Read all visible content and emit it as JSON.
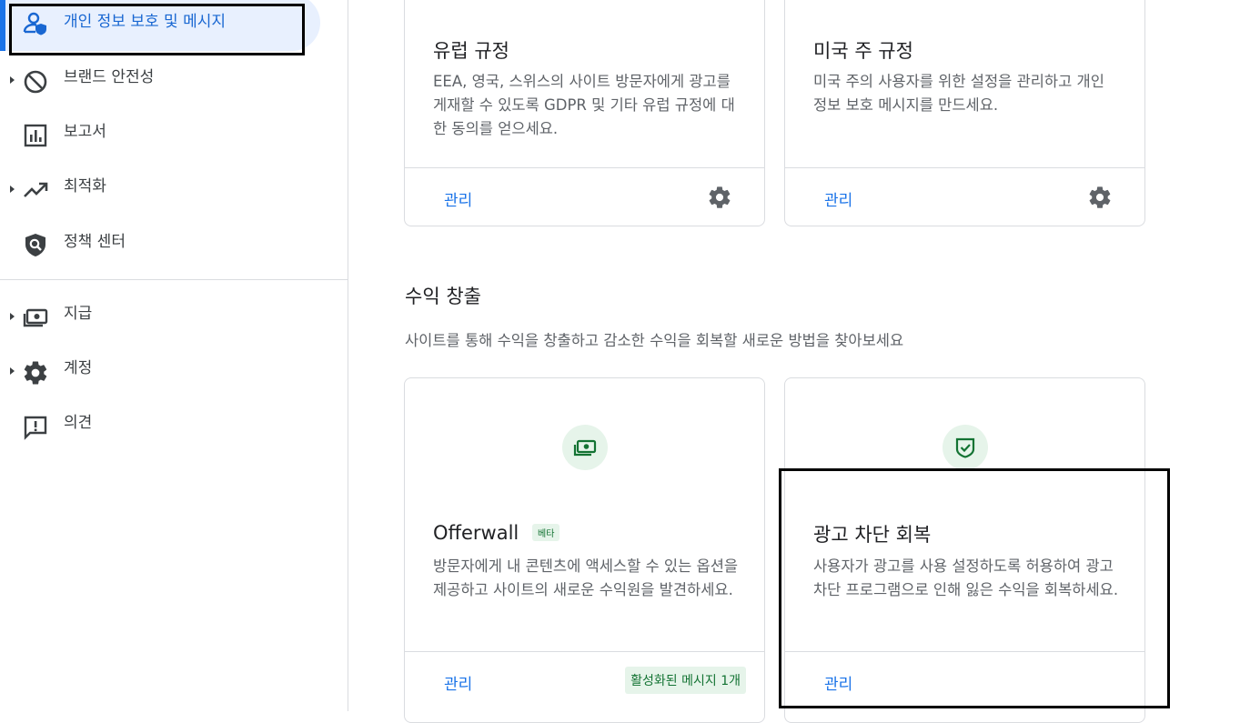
{
  "sidebar": {
    "items": [
      {
        "label": "개인 정보 보호 및 메시지",
        "icon": "privacy-messaging-icon"
      },
      {
        "label": "브랜드 안전성",
        "icon": "block-icon"
      },
      {
        "label": "보고서",
        "icon": "report-chart-icon"
      },
      {
        "label": "최적화",
        "icon": "trending-up-icon"
      },
      {
        "label": "정책 센터",
        "icon": "policy-shield-icon"
      },
      {
        "label": "지급",
        "icon": "payments-icon"
      },
      {
        "label": "계정",
        "icon": "gear-icon"
      },
      {
        "label": "의견",
        "icon": "feedback-icon"
      }
    ]
  },
  "cards": {
    "eu": {
      "title": "유럽 규정",
      "desc": "EEA, 영국, 스위스의 사이트 방문자에게 광고를 게재할 수 있도록 GDPR 및 기타 유럽 규정에 대한 동의를 얻으세요.",
      "manage": "관리"
    },
    "us": {
      "title": "미국 주 규정",
      "desc": "미국 주의 사용자를 위한 설정을 관리하고 개인 정보 보호 메시지를 만드세요.",
      "manage": "관리"
    },
    "offerwall": {
      "title": "Offerwall",
      "badge": "베타",
      "desc": "방문자에게 내 콘텐츠에 액세스할 수 있는 옵션을 제공하고 사이트의 새로운 수익원을 발견하세요.",
      "manage": "관리",
      "status": "활성화된 메시지 1개"
    },
    "adblock": {
      "title": "광고 차단 회복",
      "desc": "사용자가 광고를 사용 설정하도록 허용하여 광고 차단 프로그램으로 인해 잃은 수익을 회복하세요.",
      "manage": "관리"
    }
  },
  "monetization": {
    "title": "수익 창출",
    "desc": "사이트를 통해 수익을 창출하고 감소한 수익을 회복할 새로운 방법을 찾아보세요"
  },
  "colors": {
    "accent": "#1a73e8",
    "green_bg": "#e6f4ea",
    "green": "#137333"
  }
}
